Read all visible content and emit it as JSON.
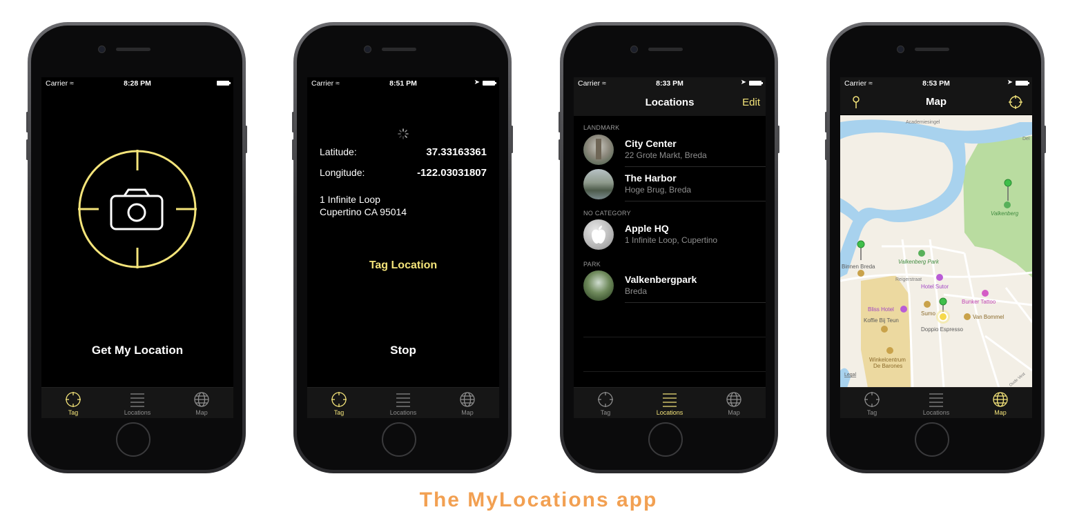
{
  "caption": "The MyLocations app",
  "status": {
    "carrier": "Carrier",
    "times": [
      "8:28 PM",
      "8:51 PM",
      "8:33 PM",
      "8:53 PM"
    ]
  },
  "tabs": [
    "Tag",
    "Locations",
    "Map"
  ],
  "accent_color": "#f4e47a",
  "screen1": {
    "button": "Get My Location"
  },
  "screen2": {
    "latitude_label": "Latitude:",
    "latitude_value": "37.33163361",
    "longitude_label": "Longitude:",
    "longitude_value": "-122.03031807",
    "address_line1": "1 Infinite Loop",
    "address_line2": "Cupertino CA 95014",
    "tag_button": "Tag Location",
    "stop_button": "Stop"
  },
  "screen3": {
    "title": "Locations",
    "edit": "Edit",
    "sections": [
      {
        "header": "LANDMARK",
        "items": [
          {
            "title": "City Center",
            "subtitle": "22 Grote Markt, Breda"
          },
          {
            "title": "The Harbor",
            "subtitle": "Hoge Brug, Breda"
          }
        ]
      },
      {
        "header": "NO CATEGORY",
        "items": [
          {
            "title": "Apple HQ",
            "subtitle": "1 Infinite Loop, Cupertino"
          }
        ]
      },
      {
        "header": "PARK",
        "items": [
          {
            "title": "Valkenbergpark",
            "subtitle": "Breda"
          }
        ]
      }
    ]
  },
  "screen4": {
    "title": "Map",
    "labels": {
      "academiesingel": "Academiesingel",
      "valkenberg": "Valkenberg",
      "valkenberg_park": "Valkenberg Park",
      "binnen_breda": "Binnen Breda",
      "reigerstraat": "Reigerstraat",
      "hotel_sutor": "Hotel Sutor",
      "bunker_tattoo": "Bunker Tattoo",
      "bliss_hotel": "Bliss Hotel",
      "sumo": "Sumo",
      "van_bommel": "Van Bommel",
      "koffie": "Koffie Bij Teun",
      "doppio": "Doppio Espresso",
      "winkel1": "Winkelcentrum",
      "winkel2": "De Barones",
      "legal": "Legal",
      "del": "Del",
      "oude_vest": "Oude Vest"
    }
  }
}
